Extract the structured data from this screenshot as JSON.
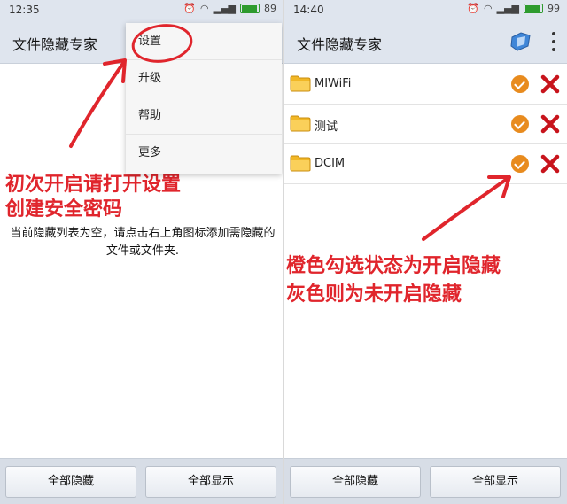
{
  "left": {
    "status": {
      "time": "12:35",
      "battery": "89"
    },
    "app_title": "文件隐藏专家",
    "menu": [
      {
        "label": "设置"
      },
      {
        "label": "升级"
      },
      {
        "label": "帮助"
      },
      {
        "label": "更多"
      }
    ],
    "empty_message": "当前隐藏列表为空，请点击右上角图标添加需隐藏的文件或文件夹.",
    "annotation": [
      "初次开启请打开设置",
      "创建安全密码"
    ],
    "buttons": {
      "hide_all": "全部隐藏",
      "show_all": "全部显示"
    }
  },
  "right": {
    "status": {
      "time": "14:40",
      "battery": "99"
    },
    "app_title": "文件隐藏专家",
    "files": [
      {
        "name": "MIWiFi"
      },
      {
        "name": "测试"
      },
      {
        "name": "DCIM"
      }
    ],
    "annotation": [
      "橙色勾选状态为开启隐藏",
      "灰色则为未开启隐藏"
    ],
    "buttons": {
      "hide_all": "全部隐藏",
      "show_all": "全部显示"
    }
  },
  "colors": {
    "annotation_red": "#e0252c",
    "check_orange": "#e88b1e",
    "bar_bg": "#dfe5ee"
  }
}
